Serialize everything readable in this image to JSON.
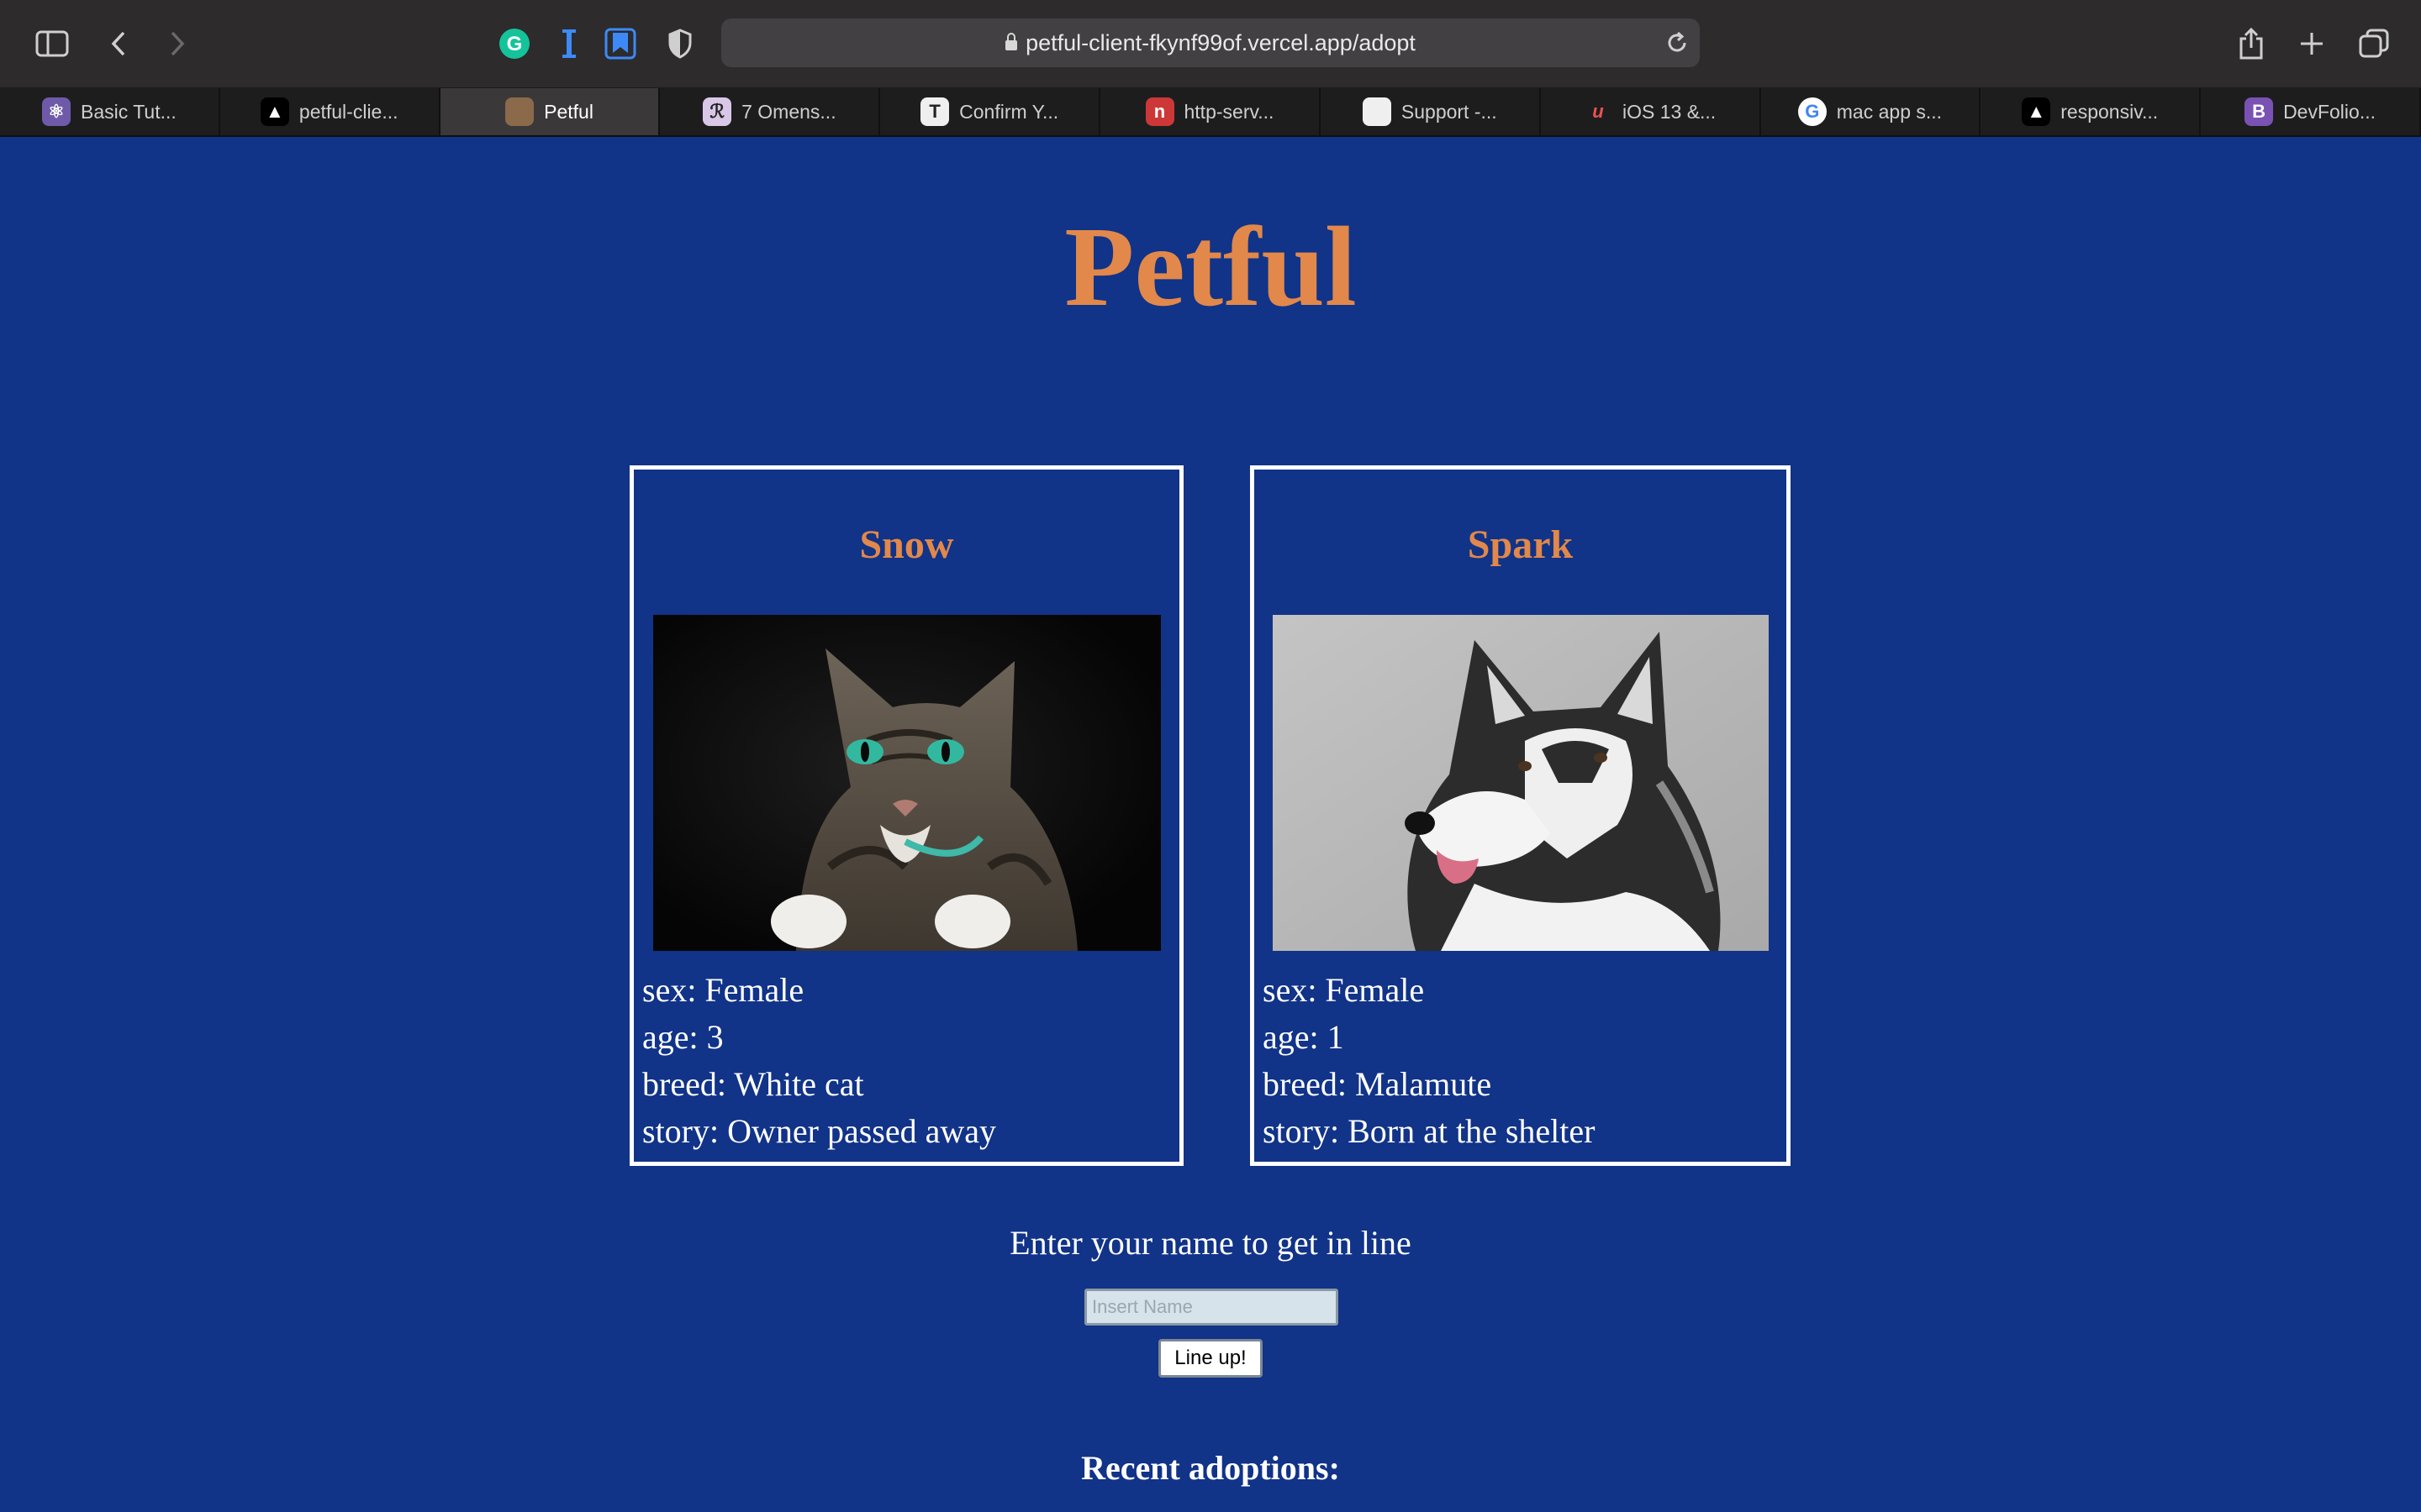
{
  "browser": {
    "url": "petful-client-fkynf99of.vercel.app/adopt",
    "tabs": [
      {
        "label": "Basic Tut...",
        "favicon": "react-icon",
        "favicon_color": "#6e5aa8",
        "favicon_char": "⚛",
        "active": false
      },
      {
        "label": "petful-clie...",
        "favicon": "vercel-icon",
        "favicon_color": "#000000",
        "favicon_char": "▲",
        "active": false
      },
      {
        "label": "Petful",
        "favicon": "cat-photo-icon",
        "favicon_color": "#8a6a4a",
        "favicon_char": "",
        "active": true
      },
      {
        "label": "7 Omens...",
        "favicon": "fairy-icon",
        "favicon_color": "#d9c7e8",
        "favicon_char": "ℛ",
        "active": false
      },
      {
        "label": "Confirm Y...",
        "favicon": "typeform-icon",
        "favicon_color": "#efefef",
        "favicon_char": "T",
        "active": false
      },
      {
        "label": "http-serv...",
        "favicon": "npm-icon",
        "favicon_color": "#cb3837",
        "favicon_char": "n",
        "active": false
      },
      {
        "label": "Support -...",
        "favicon": "apple-icon",
        "favicon_color": "#efefef",
        "favicon_char": "",
        "active": false
      },
      {
        "label": "iOS 13 &...",
        "favicon": "udemy-icon",
        "favicon_color": "#1e1d1e",
        "favicon_char": "u",
        "active": false
      },
      {
        "label": "mac app s...",
        "favicon": "google-icon",
        "favicon_color": "#ffffff",
        "favicon_char": "G",
        "active": false
      },
      {
        "label": "responsiv...",
        "favicon": "vercel-icon",
        "favicon_color": "#000000",
        "favicon_char": "▲",
        "active": false
      },
      {
        "label": "DevFolio...",
        "favicon": "bootstrap-icon",
        "favicon_color": "#7952b3",
        "favicon_char": "B",
        "active": false
      }
    ]
  },
  "page": {
    "title": "Petful",
    "pets": [
      {
        "name": "Snow",
        "image": "tabby-cat-photo",
        "sex": "sex: Female",
        "age": "age: 3",
        "breed": "breed: White cat",
        "story": "story: Owner passed away"
      },
      {
        "name": "Spark",
        "image": "husky-dog-photo",
        "sex": "sex: Female",
        "age": "age: 1",
        "breed": "breed: Malamute",
        "story": "story: Born at the shelter"
      }
    ],
    "signup": {
      "prompt": "Enter your name to get in line",
      "placeholder": "Insert Name",
      "button": "Line up!"
    },
    "recent_heading": "Recent adoptions:"
  },
  "colors": {
    "background": "#113388",
    "accent": "#e1884a",
    "text": "#ffffff"
  }
}
